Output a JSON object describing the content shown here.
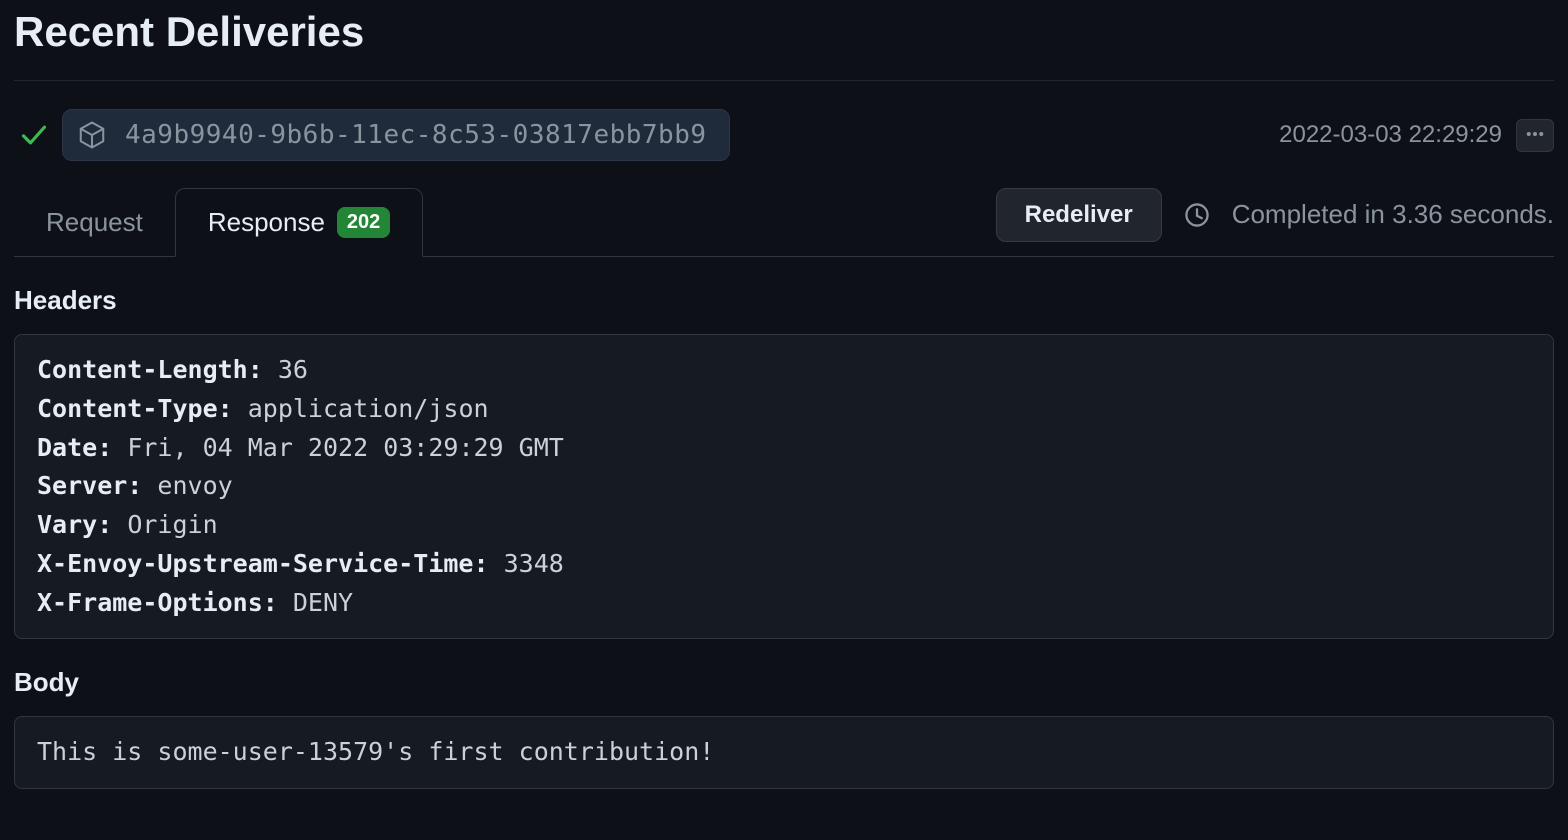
{
  "page": {
    "title": "Recent Deliveries"
  },
  "delivery": {
    "id": "4a9b9940-9b6b-11ec-8c53-03817ebb7bb9",
    "timestamp": "2022-03-03 22:29:29"
  },
  "tabs": {
    "request_label": "Request",
    "response_label": "Response",
    "status_code": "202"
  },
  "actions": {
    "redeliver_label": "Redeliver",
    "completed_text": "Completed in 3.36 seconds."
  },
  "headers_section": {
    "title": "Headers",
    "items": [
      {
        "name": "Content-Length:",
        "value": "36"
      },
      {
        "name": "Content-Type:",
        "value": "application/json"
      },
      {
        "name": "Date:",
        "value": "Fri, 04 Mar 2022 03:29:29 GMT"
      },
      {
        "name": "Server:",
        "value": "envoy"
      },
      {
        "name": "Vary:",
        "value": "Origin"
      },
      {
        "name": "X-Envoy-Upstream-Service-Time:",
        "value": "3348"
      },
      {
        "name": "X-Frame-Options:",
        "value": "DENY"
      }
    ]
  },
  "body_section": {
    "title": "Body",
    "content": "This is some-user-13579's first contribution!"
  }
}
